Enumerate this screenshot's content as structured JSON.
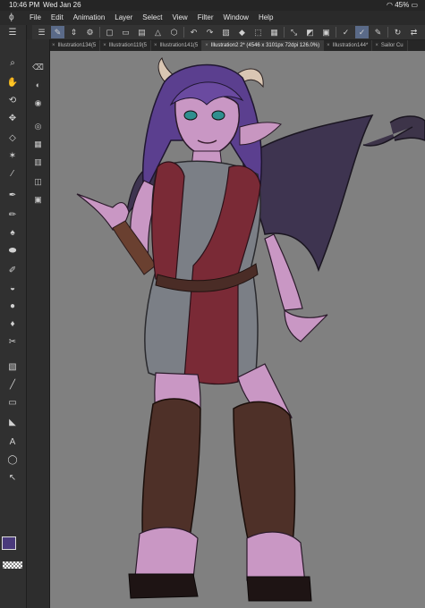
{
  "status_bar": {
    "time": "10:46 PM",
    "date": "Wed Jan 26",
    "battery": "45%"
  },
  "menu": {
    "items": [
      "File",
      "Edit",
      "Animation",
      "Layer",
      "Select",
      "View",
      "Filter",
      "Window",
      "Help"
    ]
  },
  "tabs": [
    {
      "label": "Illustration134(5"
    },
    {
      "label": "Illustration119(5"
    },
    {
      "label": "Illustration141(5"
    },
    {
      "label": "Illustration2 2* (4546 x 3101px 72dpi 126.0%)",
      "active": true
    },
    {
      "label": "Illustration144*"
    },
    {
      "label": "Sailor Cu"
    }
  ],
  "colors": {
    "main": "#4a3a7c",
    "sub": "#f0f0f0",
    "canvas_bg": "#808080",
    "active_tab": "#3b3b3b"
  },
  "icons": {
    "left_tools": [
      "magnifier-icon",
      "hand-icon",
      "rotate-icon",
      "move-icon",
      "eraser-icon",
      "star-auto-select-icon",
      "eyedropper-icon",
      "pen-icon",
      "pencil-icon",
      "brush-icon",
      "airbrush-icon",
      "marker-icon",
      "fill-icon",
      "blend-icon",
      "water-drop-icon",
      "decoration-icon",
      "gradient-icon",
      "line-icon",
      "frame-icon",
      "ruler-icon",
      "text-icon",
      "balloon-icon",
      "correct-line-icon"
    ],
    "sub_tools": [
      "sub-eraser-icon",
      "sub-fill-icon",
      "sub-blend-icon",
      "sub-layer-icon",
      "sub-page-icon",
      "sub-folder-icon",
      "sub-stack-icon",
      "sub-camera-icon"
    ]
  }
}
